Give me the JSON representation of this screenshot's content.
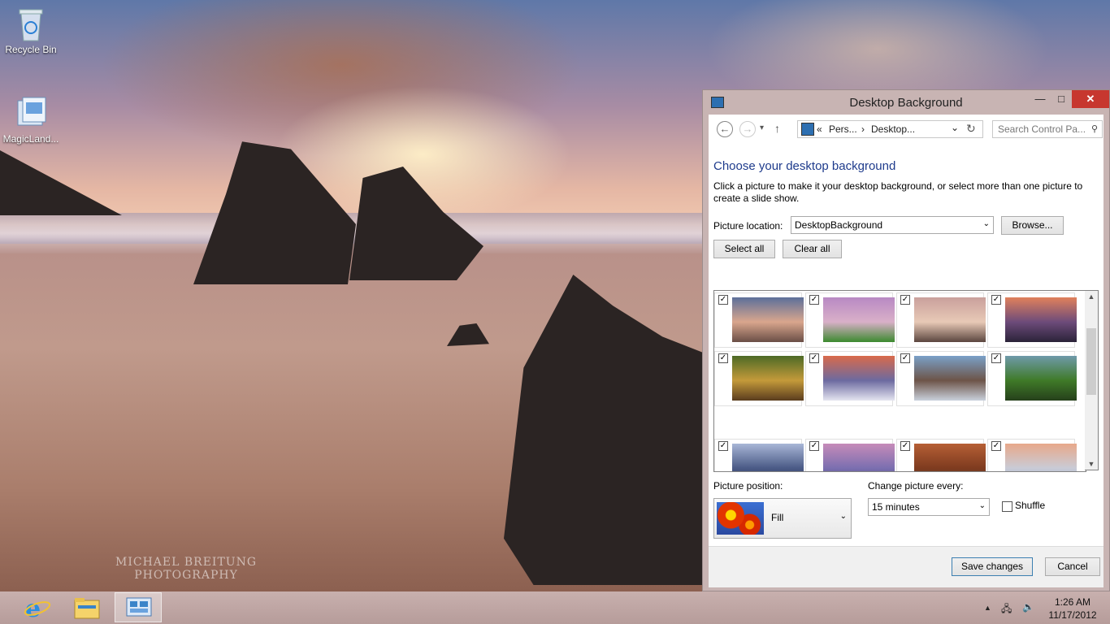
{
  "desktop": {
    "icons": [
      {
        "label": "Recycle Bin"
      },
      {
        "label": "MagicLand..."
      }
    ],
    "credit_line1": "MICHAEL BREITUNG",
    "credit_line2": "PHOTOGRAPHY"
  },
  "window": {
    "title": "Desktop Background",
    "min_glyph": "—",
    "max_glyph": "□",
    "close_glyph": "✕",
    "nav": {
      "back_glyph": "←",
      "forward_glyph": "→",
      "recent_glyph": "▾",
      "up_glyph": "↑",
      "crumbs_prefix": "«",
      "crumb1": "Pers...",
      "crumb_sep": "›",
      "crumb2": "Desktop...",
      "dropdown_glyph": "⌄",
      "refresh_glyph": "↻",
      "search_placeholder": "Search Control Pa...",
      "search_glyph": "⚲"
    },
    "heading": "Choose your desktop background",
    "description": "Click a picture to make it your desktop background, or select more than one picture to create a slide show.",
    "picture_location_label": "Picture location:",
    "picture_location_value": "DesktopBackground",
    "browse_label": "Browse...",
    "select_all_label": "Select all",
    "clear_all_label": "Clear all",
    "gallery": {
      "check_glyph": "✓",
      "tiles": [
        {
          "name": "beach-rocks",
          "checked": true,
          "colors": [
            "#5c6f9a",
            "#d9a68d",
            "#6a4e46"
          ]
        },
        {
          "name": "meadow-cabin",
          "checked": true,
          "colors": [
            "#b889c4",
            "#d9b0c8",
            "#3c8a2f"
          ]
        },
        {
          "name": "rocky-shore",
          "checked": true,
          "colors": [
            "#c9a09c",
            "#e8c9b6",
            "#5b463f"
          ]
        },
        {
          "name": "purple-sunset",
          "checked": true,
          "colors": [
            "#e0815b",
            "#6d4b7a",
            "#2b2339"
          ]
        },
        {
          "name": "waterfall-forest",
          "checked": true,
          "colors": [
            "#4d6a26",
            "#c49a3a",
            "#5a3c1e"
          ]
        },
        {
          "name": "sea-sunset",
          "checked": true,
          "colors": [
            "#d96a4b",
            "#6c6aa0",
            "#e4e4f0"
          ]
        },
        {
          "name": "cascade-rocks",
          "checked": true,
          "colors": [
            "#7aa0c8",
            "#6d5448",
            "#c9d0dc"
          ]
        },
        {
          "name": "green-marsh",
          "checked": true,
          "colors": [
            "#6f9aaa",
            "#3f7a28",
            "#26401b"
          ]
        },
        {
          "name": "twilight-sea",
          "checked": true,
          "colors": [
            "#a8b6d6",
            "#4a5a86",
            "#2d3150"
          ]
        },
        {
          "name": "coastal-dusk",
          "checked": true,
          "colors": [
            "#c68bb9",
            "#7b6fb0",
            "#3e3f6c"
          ]
        },
        {
          "name": "canyon-bend",
          "checked": true,
          "colors": [
            "#b65f35",
            "#7e3b1f",
            "#4c3a34"
          ]
        },
        {
          "name": "misty-lake",
          "checked": true,
          "colors": [
            "#e8a88a",
            "#c9cbd6",
            "#8aa0c0"
          ]
        }
      ]
    },
    "scroll_up_glyph": "▲",
    "scroll_down_glyph": "▼",
    "picture_position_label": "Picture position:",
    "picture_position_value": "Fill",
    "change_every_label": "Change picture every:",
    "change_every_value": "15 minutes",
    "shuffle_label": "Shuffle",
    "select_arrow_glyph": "⌄",
    "save_label": "Save changes",
    "cancel_label": "Cancel"
  },
  "taskbar": {
    "tray_up_glyph": "▲",
    "network_glyph": "🖧",
    "volume_glyph": "🔈",
    "time": "1:26 AM",
    "date": "11/17/2012"
  }
}
